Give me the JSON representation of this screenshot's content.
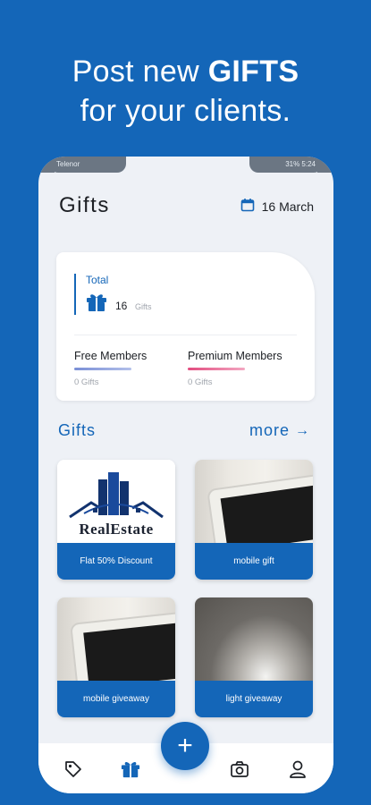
{
  "headline": {
    "line1_prefix": "Post new ",
    "line1_bold": "GIFTS",
    "line2": "for your clients."
  },
  "status": {
    "carrier": "Telenor",
    "right": "31%  5:24"
  },
  "header": {
    "title": "Gifts",
    "date": "16 March"
  },
  "summary": {
    "total_label": "Total",
    "total_count": "16",
    "total_unit": "Gifts",
    "free_label": "Free Members",
    "free_value": "0 Gifts",
    "premium_label": "Premium Members",
    "premium_value": "0 Gifts"
  },
  "gifts_section": {
    "title": "Gifts",
    "more_label": "more",
    "more_arrow": "→"
  },
  "cards": [
    {
      "caption": "Flat 50% Discount",
      "logo_text": "RealEstate"
    },
    {
      "caption": "mobile gift"
    },
    {
      "caption": "mobile giveaway"
    },
    {
      "caption": "light giveaway"
    }
  ],
  "fab": {
    "label": "+"
  },
  "tabs": {
    "icons": [
      "tag-icon",
      "gift-icon",
      "camera-icon",
      "user-icon"
    ]
  },
  "colors": {
    "accent": "#1466b8",
    "free_line": "#7a8fd6",
    "premium_line": "#e24c7f"
  }
}
